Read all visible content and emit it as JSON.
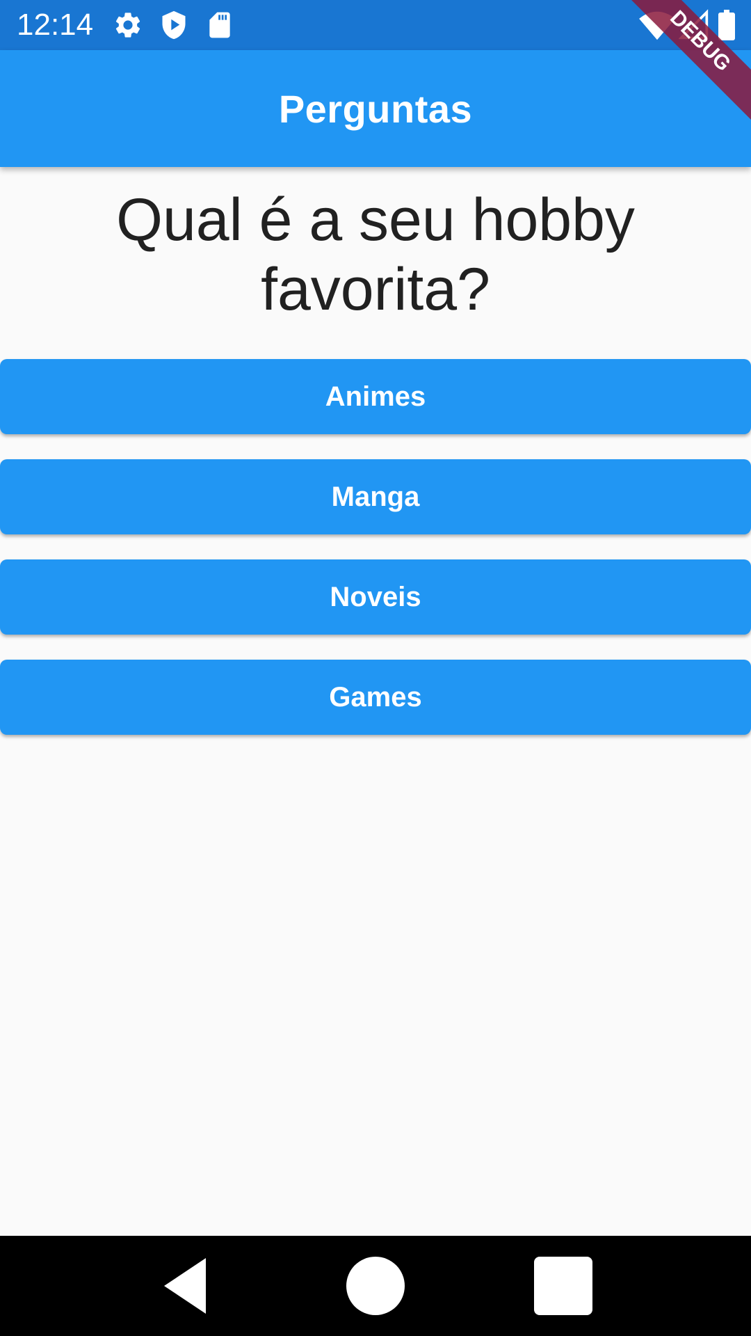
{
  "status_bar": {
    "time": "12:14",
    "left_icons": [
      "gear-icon",
      "shield-play-icon",
      "sd-card-icon"
    ],
    "right_icons": [
      "wifi-icon",
      "signal-icon",
      "battery-icon"
    ]
  },
  "app_bar": {
    "title": "Perguntas"
  },
  "question": {
    "text": "Qual é a seu hobby favorita?"
  },
  "answers": [
    {
      "label": "Animes"
    },
    {
      "label": "Manga"
    },
    {
      "label": "Noveis"
    },
    {
      "label": "Games"
    }
  ],
  "debug_banner": {
    "label": "DEBUG"
  },
  "nav_bar": {
    "icons": [
      "back-icon",
      "home-icon",
      "recents-icon"
    ]
  },
  "colors": {
    "status_bar": "#1976d2",
    "primary": "#2196f3",
    "background": "#fafafa",
    "question_text": "#212121",
    "debug_banner": "#8b1a3c"
  }
}
